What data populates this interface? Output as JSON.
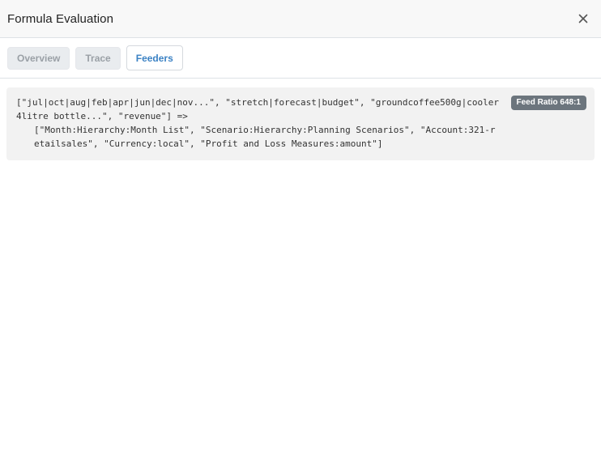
{
  "dialog": {
    "title": "Formula Evaluation",
    "close_icon": "close-icon"
  },
  "tabs": [
    {
      "label": "Overview",
      "active": false
    },
    {
      "label": "Trace",
      "active": false
    },
    {
      "label": "Feeders",
      "active": true
    }
  ],
  "feeder": {
    "expression": "[\"jul|oct|aug|feb|apr|jun|dec|nov...\", \"stretch|forecast|budget\", \"groundcoffee500g|cooler4litre bottle...\", \"revenue\"] =>",
    "target": "[\"Month:Hierarchy:Month List\", \"Scenario:Hierarchy:Planning Scenarios\", \"Account:321-retailsales\", \"Currency:local\", \"Profit and Loss Measures:amount\"]",
    "badge": "Feed Ratio 648:1"
  },
  "colors": {
    "accent": "#3b82c4",
    "badge_bg": "#6c757d",
    "panel_bg": "#f2f2f2"
  }
}
